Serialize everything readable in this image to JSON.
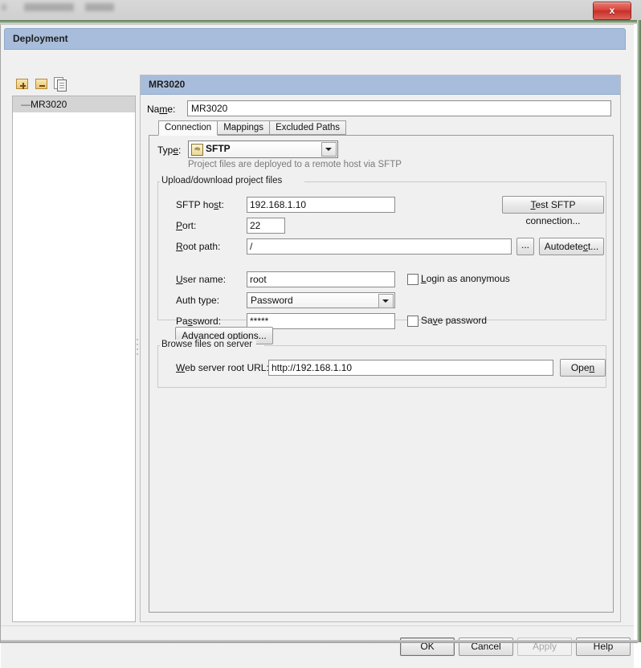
{
  "window": {
    "close_label": "x"
  },
  "dialog": {
    "title": "Deployment"
  },
  "tree": {
    "toolbar": [
      {
        "name": "add-server-button",
        "icon": "plus-square-icon"
      },
      {
        "name": "remove-server-button",
        "icon": "minus-square-icon"
      },
      {
        "name": "copy-server-button",
        "icon": "copy-pages-icon"
      }
    ],
    "items": [
      {
        "label": "MR3020",
        "selected": true
      }
    ]
  },
  "content": {
    "header_title": "MR3020",
    "name_label": "Name:",
    "name_value": "MR3020",
    "tabs": [
      {
        "label": "Connection",
        "active": true
      },
      {
        "label": "Mappings",
        "active": false
      },
      {
        "label": "Excluded Paths",
        "active": false
      }
    ],
    "connection": {
      "type_label": "Type:",
      "type_value": "SFTP",
      "type_icon_text": "sftp",
      "type_hint": "Project files are deployed to a remote host via SFTP",
      "upload_group_title": "Upload/download project files",
      "sftp_host_label": "SFTP host:",
      "sftp_host_value": "192.168.1.10",
      "test_connection_label": "Test SFTP connection...",
      "port_label": "Port:",
      "port_value": "22",
      "root_path_label": "Root path:",
      "root_path_value": "/",
      "browse_ellipsis_label": "...",
      "autodetect_label": "Autodetect...",
      "user_name_label": "User name:",
      "user_name_value": "root",
      "login_anonymous_label": "Login as anonymous",
      "login_anonymous_checked": false,
      "auth_type_label": "Auth type:",
      "auth_type_value": "Password",
      "password_label": "Password:",
      "password_value": "*****",
      "save_password_label": "Save password",
      "save_password_checked": false,
      "advanced_options_label": "Advanced options...",
      "browse_group_title": "Browse files on server",
      "web_root_label": "Web server root URL:",
      "web_root_value": "http://192.168.1.10",
      "open_label": "Open"
    }
  },
  "buttons": {
    "ok": "OK",
    "cancel": "Cancel",
    "apply": "Apply",
    "help": "Help"
  },
  "colors": {
    "header_blue": "#a8bddb",
    "dialog_bg": "#f0f0f0",
    "close_red": "#d9443c",
    "tree_selected": "#d4d4d4",
    "hint_gray": "#7a7a7a"
  }
}
